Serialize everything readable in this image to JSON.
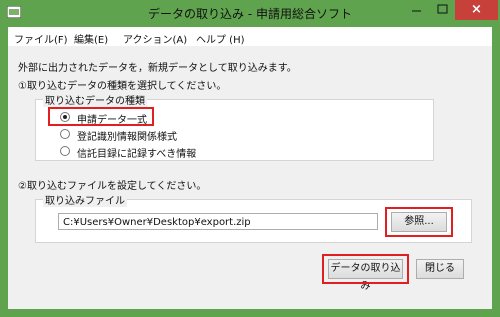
{
  "window": {
    "title": "データの取り込み - 申請用総合ソフト",
    "close_icon": "×"
  },
  "menu": [
    {
      "label": "ファイル(F)"
    },
    {
      "label": "編集(E)"
    },
    {
      "label": "アクション(A)"
    },
    {
      "label": "ヘルプ (H)"
    }
  ],
  "intro": "外部に出力されたデータを，新規データとして取り込みます。",
  "step1": "①取り込むデータの種類を選択してください。",
  "data_type_group": {
    "title": "取り込むデータの種類",
    "options": [
      {
        "label": "申請データ一式",
        "selected": true
      },
      {
        "label": "登記識別情報関係様式",
        "selected": false
      },
      {
        "label": "信託目録に記録すべき情報",
        "selected": false
      }
    ]
  },
  "step2": "②取り込むファイルを設定してください。",
  "file_group": {
    "title": "取り込みファイル",
    "path_value": "C:¥Users¥Owner¥Desktop¥export.zip",
    "browse_label": "参照..."
  },
  "footer": {
    "import_label": "データの取り込み",
    "close_label": "閉じる"
  },
  "colors": {
    "titlebar": "#5fa34e",
    "close_button": "#c7403a",
    "highlight": "#e02020"
  }
}
